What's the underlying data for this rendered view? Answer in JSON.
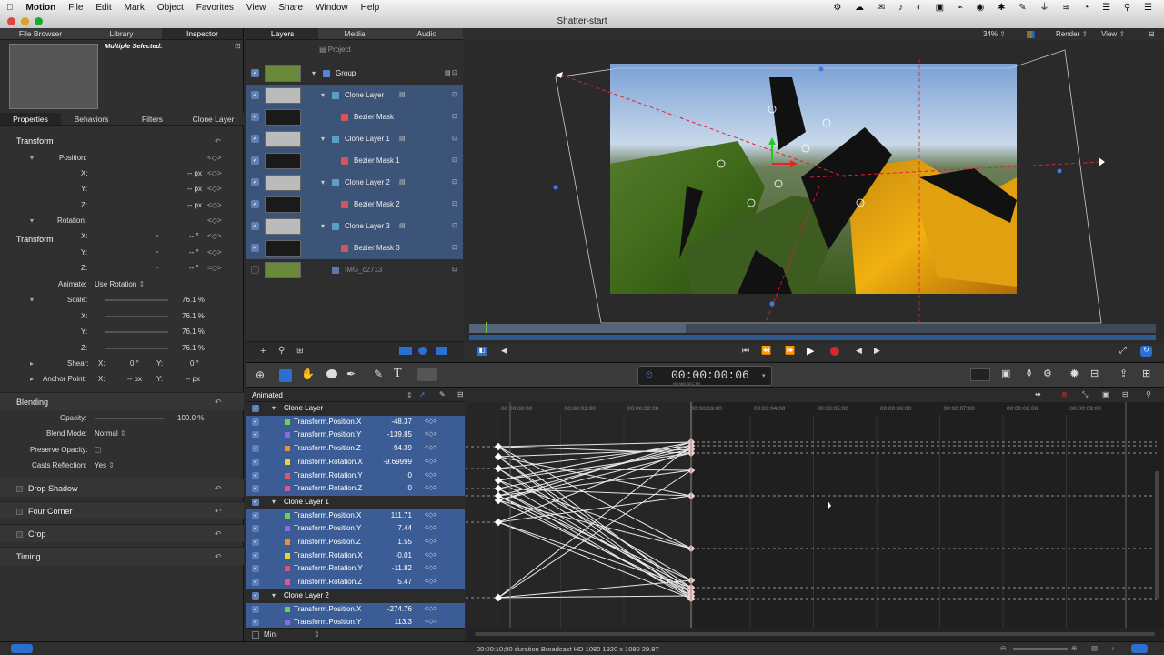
{
  "menubar": {
    "app": "Motion",
    "items": [
      "File",
      "Edit",
      "Mark",
      "Object",
      "Favorites",
      "View",
      "Share",
      "Window",
      "Help"
    ]
  },
  "window": {
    "title": "Shatter-start"
  },
  "left": {
    "tabs": [
      "File Browser",
      "Library",
      "Inspector"
    ],
    "preview_label": "Multiple Selected.",
    "subtabs": [
      "Properties",
      "Behaviors",
      "Filters",
      "Clone Layer"
    ],
    "transform_title": "Transform",
    "position_label": "Position:",
    "x_label": "X:",
    "y_label": "Y:",
    "z_label": "Z:",
    "px_value": "-- px",
    "rotation_label": "Rotation:",
    "deg_value": "-- °",
    "animate_label": "Animate:",
    "animate_value": "Use Rotation",
    "scale_label": "Scale:",
    "scale_value": "76.1 %",
    "shear_label": "Shear:",
    "shear_x": "0 °",
    "shear_y": "0 °",
    "anchor_label": "Anchor Point:",
    "anchor_x": "-- px",
    "anchor_y": "-- px",
    "blending_title": "Blending",
    "opacity_label": "Opacity:",
    "opacity_value": "100.0 %",
    "blend_label": "Blend Mode:",
    "blend_value": "Normal",
    "preserve_label": "Preserve Opacity:",
    "casts_label": "Casts Reflection:",
    "casts_value": "Yes",
    "drop_shadow": "Drop Shadow",
    "four_corner": "Four Corner",
    "crop": "Crop",
    "timing": "Timing"
  },
  "layers": {
    "tabs": [
      "Layers",
      "Media",
      "Audio"
    ],
    "project": "Project",
    "rows": [
      {
        "name": "Group",
        "type": "group"
      },
      {
        "name": "Clone Layer",
        "type": "clone"
      },
      {
        "name": "Bezier Mask",
        "type": "mask"
      },
      {
        "name": "Clone Layer 1",
        "type": "clone"
      },
      {
        "name": "Bezier Mask 1",
        "type": "mask"
      },
      {
        "name": "Clone Layer 2",
        "type": "clone"
      },
      {
        "name": "Bezier Mask 2",
        "type": "mask"
      },
      {
        "name": "Clone Layer 3",
        "type": "clone"
      },
      {
        "name": "Bezier Mask 3",
        "type": "mask"
      },
      {
        "name": "IMG_c2713",
        "type": "image"
      }
    ]
  },
  "canvas": {
    "zoom": "34%",
    "render": "Render",
    "view": "View"
  },
  "toolbar": {
    "timecode": "00:00:00:06",
    "tc_units": "HR   MIN   SEC   FR"
  },
  "timeline": {
    "filter": "Animated",
    "ruler": [
      "00:00:00:00",
      "00:00:01:00",
      "00:00:02:00",
      "00:00:03:00",
      "00:00:04:00",
      "00:00:05:00",
      "00:00:06:00",
      "00:00:07:00",
      "00:00:08:00",
      "00:00:09:00"
    ],
    "mini": "Mini",
    "rows": [
      {
        "kind": "hdr",
        "name": "Clone Layer"
      },
      {
        "kind": "ch",
        "name": "Transform.Position.X",
        "value": "-48.37",
        "color": "#6fd14a"
      },
      {
        "kind": "ch",
        "name": "Transform.Position.Y",
        "value": "-139.85",
        "color": "#8a6be0"
      },
      {
        "kind": "ch",
        "name": "Transform.Position.Z",
        "value": "-94.39",
        "color": "#f0902a"
      },
      {
        "kind": "ch",
        "name": "Transform.Rotation.X",
        "value": "-9.69999",
        "color": "#f0d22a"
      },
      {
        "kind": "ch",
        "name": "Transform.Rotation.Y",
        "value": "0",
        "color": "#e8506a"
      },
      {
        "kind": "ch",
        "name": "Transform.Rotation.Z",
        "value": "0",
        "color": "#e85090"
      },
      {
        "kind": "hdr",
        "name": "Clone Layer 1"
      },
      {
        "kind": "ch",
        "name": "Transform.Position.X",
        "value": "111.71",
        "color": "#6fd14a"
      },
      {
        "kind": "ch",
        "name": "Transform.Position.Y",
        "value": "7.44",
        "color": "#8a6be0"
      },
      {
        "kind": "ch",
        "name": "Transform.Position.Z",
        "value": "1.55",
        "color": "#f0902a"
      },
      {
        "kind": "ch",
        "name": "Transform.Rotation.X",
        "value": "-0.01",
        "color": "#f0d22a"
      },
      {
        "kind": "ch",
        "name": "Transform.Rotation.Y",
        "value": "-11.82",
        "color": "#e8506a"
      },
      {
        "kind": "ch",
        "name": "Transform.Rotation.Z",
        "value": "5.47",
        "color": "#e85090"
      },
      {
        "kind": "hdr",
        "name": "Clone Layer 2"
      },
      {
        "kind": "ch",
        "name": "Transform.Position.X",
        "value": "-274.76",
        "color": "#6fd14a"
      },
      {
        "kind": "ch",
        "name": "Transform.Position.Y",
        "value": "113.3",
        "color": "#8a6be0"
      }
    ]
  },
  "status": {
    "info": "00:00:10;00 duration Broadcast HD 1080 1920 x 1080 29.97"
  }
}
